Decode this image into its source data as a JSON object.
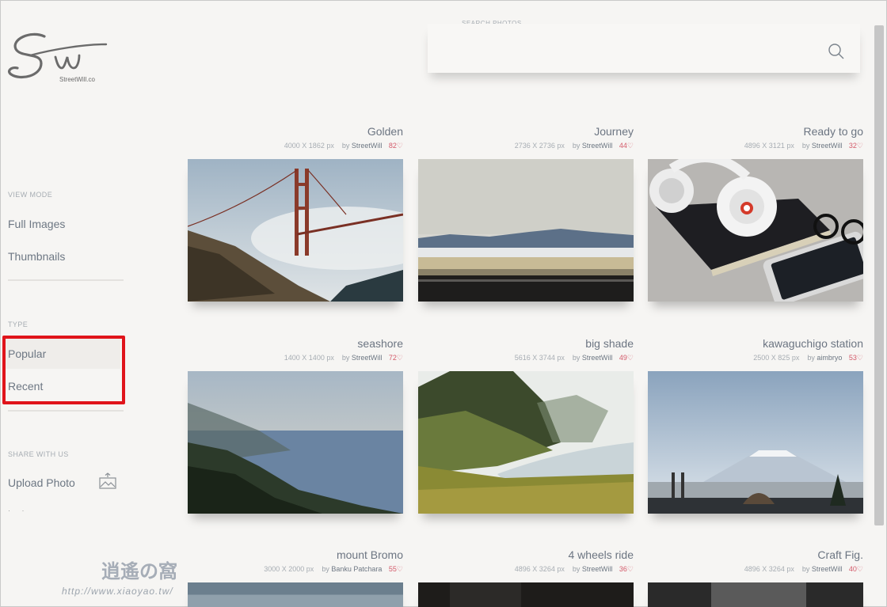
{
  "logo": {
    "brand_text": "StreetWill.co"
  },
  "sidebar": {
    "view_mode_title": "VIEW MODE",
    "view_mode_items": [
      {
        "label": "Full Images"
      },
      {
        "label": "Thumbnails"
      }
    ],
    "type_title": "TYPE",
    "type_items": [
      {
        "label": "Popular"
      },
      {
        "label": "Recent"
      }
    ],
    "share_title": "SHARE WITH US",
    "upload_label": "Upload Photo"
  },
  "search": {
    "label": "SEARCH PHOTOS",
    "value": ""
  },
  "photos": [
    {
      "title": "Golden",
      "size": "4000 X 1862 px",
      "by": "by",
      "author": "StreetWill",
      "likes": "82",
      "scene": "bridge"
    },
    {
      "title": "Journey",
      "size": "2736 X 2736 px",
      "by": "by",
      "author": "StreetWill",
      "likes": "44",
      "scene": "journey"
    },
    {
      "title": "Ready to go",
      "size": "4896 X 3121 px",
      "by": "by",
      "author": "StreetWill",
      "likes": "32",
      "scene": "headphones"
    },
    {
      "title": "seashore",
      "size": "1400 X 1400 px",
      "by": "by",
      "author": "StreetWill",
      "likes": "72",
      "scene": "seashore"
    },
    {
      "title": "big shade",
      "size": "5616 X 3744 px",
      "by": "by",
      "author": "StreetWill",
      "likes": "49",
      "scene": "bigshade"
    },
    {
      "title": "kawaguchigo station",
      "size": "2500 X 825 px",
      "by": "by",
      "author": "aimbryo",
      "likes": "53",
      "scene": "fuji"
    },
    {
      "title": "mount Bromo",
      "size": "3000 X 2000 px",
      "by": "by",
      "author": "Banku Patchara",
      "likes": "55",
      "scene": "dark1"
    },
    {
      "title": "4 wheels ride",
      "size": "4896 X 3264 px",
      "by": "by",
      "author": "StreetWill",
      "likes": "36",
      "scene": "dark2"
    },
    {
      "title": "Craft Fig.",
      "size": "4896 X 3264 px",
      "by": "by",
      "author": "StreetWill",
      "likes": "40",
      "scene": "dark3"
    }
  ],
  "watermark": {
    "line1": "逍遙の窩",
    "line2": "http://www.xiaoyao.tw/"
  },
  "colors": {
    "accent_red": "#e0141b",
    "like_pink": "#d35a6a",
    "background": "#f6f5f3"
  }
}
